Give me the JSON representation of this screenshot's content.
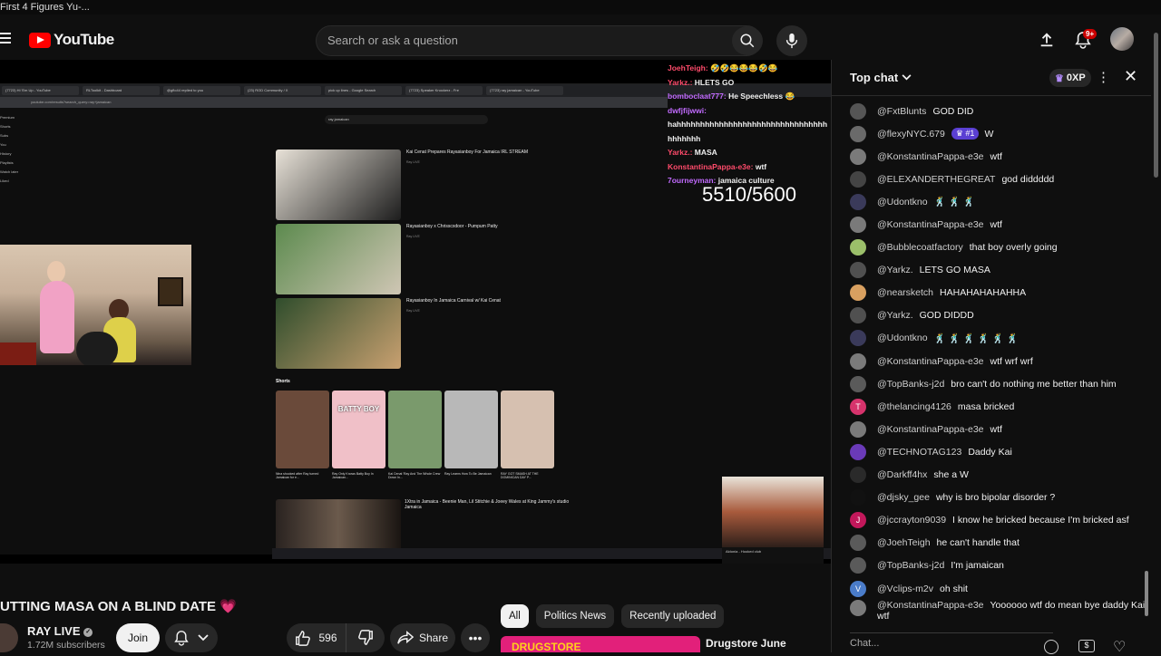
{
  "window": {
    "title": "First 4 Figures Yu-..."
  },
  "header": {
    "logo_text": "YouTube",
    "search_placeholder": "Search or ask a question",
    "notifications_badge": "9+"
  },
  "player": {
    "browser_tabs": [
      "(7723) Hi 'Em Up - YouTube",
      "RLToolkit - Dashboard",
      "@gflo44 replied to you",
      "(23) ROD Community / X",
      "pick up lines - Google Search",
      "(7723) Speaker Knockerz - Fre",
      "(7723) ray jamaican - YouTube"
    ],
    "url": "youtube.com/results?search_query=ray+jamaican",
    "mini_search": "ray jamaican",
    "results": [
      {
        "title": "Kai Cenat Prepares Rayasianboy For Jamaica IRL STREAM",
        "channel": "Ray LIVE",
        "thumb_colors": [
          "#e8e2d8",
          "#1d1d1d"
        ]
      },
      {
        "title": "Rayasianboy x Chrisscxdoor - Pumpum Patty",
        "channel": "Ray LIVE",
        "thumb_colors": [
          "#5c8a4e",
          "#cfc6b4"
        ]
      },
      {
        "title": "Rayasianboy In Jamaica Carnival w/ Kai Cenat",
        "channel": "Ray LIVE",
        "thumb_colors": [
          "#2f4d2c",
          "#c8a070"
        ]
      }
    ],
    "shorts_label": "Shorts",
    "shorts": [
      {
        "caption": "Nina shocked after Ray turned Jamaican for e...",
        "color": "#6a4a3a"
      },
      {
        "caption": "Ray Only Knows Batty Boy In Jamaican...",
        "color": "#f0c0c8",
        "text": "BATTY BOY"
      },
      {
        "caption": "Kai Cenat 'Ray And The Whole Crew Down In...",
        "color": "#7a9a6c"
      },
      {
        "caption": "Ray Learns How To Be Jamaican",
        "color": "#b8b8b8"
      },
      {
        "caption": "RAY GOT SMASH AT THE DOMINICAN DAY P...",
        "color": "#d6c0b0"
      }
    ],
    "bottom_result": "1Xtra in Jamaica - Beenie Man, Lil Stitchie & Joeey Wales at King Jammy's studio Jamaica",
    "overlay_chat": [
      {
        "name": "JoehTeigh:",
        "text": "🤣🤣😂😂😂🤣😂",
        "color": "r"
      },
      {
        "name": "Yarkz.:",
        "text": "HLETS GO",
        "color": "r"
      },
      {
        "name": "bomboclaat777:",
        "text": "He Speechless 😂",
        "color": "n"
      },
      {
        "name": "dwfjfijwwi:",
        "text": "hahhhhhhhhhhhhhhhhhhhhhhhhhhhhhhhh hhhhhhh",
        "color": "n"
      },
      {
        "name": "Yarkz.:",
        "text": "MASA",
        "color": "r"
      },
      {
        "name": "KonstantinaPappa-e3e:",
        "text": "wtf",
        "color": "r"
      },
      {
        "name": "7ourneyman:",
        "text": "jamaica culture",
        "color": "n"
      }
    ],
    "counter": "5510/5600",
    "mini_caption": "Aldonia - Hooked club"
  },
  "video": {
    "title": "UTTING MASA ON A BLIND DATE",
    "title_emoji": "💗",
    "channel": "RAY LIVE",
    "subscribers": "1.72M subscribers",
    "join_label": "Join",
    "likes": "596",
    "share_label": "Share"
  },
  "chips": [
    "All",
    "Politics News",
    "Recently uploaded"
  ],
  "ad": {
    "banner_text": "DRUGSTORE",
    "title": "Drugstore June"
  },
  "chat": {
    "title": "Top chat",
    "xp": "0XP",
    "input_placeholder": "Chat...",
    "messages": [
      {
        "author": "@FxtBlunts",
        "text": "GOD DID",
        "avatar_color": "#555555",
        "initial": ""
      },
      {
        "author": "@flexyNYC.679",
        "text": "W",
        "avatar_color": "#6a6a6a",
        "initial": "",
        "badge": "#1"
      },
      {
        "author": "@KonstantinaPappa-e3e",
        "text": "wtf",
        "avatar_color": "#7a7a7a",
        "initial": ""
      },
      {
        "author": "@ELEXANDERTHEGREAT",
        "text": "god diddddd",
        "avatar_color": "#444444",
        "initial": ""
      },
      {
        "author": "@Udontkno",
        "text": "🕺 🕺 🕺",
        "avatar_color": "#3a3a5a",
        "initial": ""
      },
      {
        "author": "@KonstantinaPappa-e3e",
        "text": "wtf",
        "avatar_color": "#7a7a7a",
        "initial": ""
      },
      {
        "author": "@Bubblecoatfactory",
        "text": "that boy overly going",
        "avatar_color": "#9bbf6a",
        "initial": ""
      },
      {
        "author": "@Yarkz.",
        "text": "LETS GO MASA",
        "avatar_color": "#505050",
        "initial": ""
      },
      {
        "author": "@nearsketch",
        "text": "HAHAHAHAHAHHA",
        "avatar_color": "#d8a060",
        "initial": ""
      },
      {
        "author": "@Yarkz.",
        "text": "GOD DIDDD",
        "avatar_color": "#505050",
        "initial": ""
      },
      {
        "author": "@Udontkno",
        "text": "🕺 🕺 🕺 🕺 🕺 🕺",
        "avatar_color": "#3a3a5a",
        "initial": ""
      },
      {
        "author": "@KonstantinaPappa-e3e",
        "text": "wtf wrf wrf",
        "avatar_color": "#7a7a7a",
        "initial": ""
      },
      {
        "author": "@TopBanks-j2d",
        "text": "bro can't do nothing me better than him",
        "avatar_color": "#5a5a5a",
        "initial": ""
      },
      {
        "author": "@thelancing4126",
        "text": "masa bricked",
        "avatar_color": "#d6336c",
        "initial": "T"
      },
      {
        "author": "@KonstantinaPappa-e3e",
        "text": "wtf",
        "avatar_color": "#7a7a7a",
        "initial": ""
      },
      {
        "author": "@TECHNOTAG123",
        "text": "Daddy Kai",
        "avatar_color": "#6a3ab8",
        "initial": ""
      },
      {
        "author": "@Darkff4hx",
        "text": "she a W",
        "avatar_color": "#2a2a2a",
        "initial": ""
      },
      {
        "author": "@djsky_gee",
        "text": "why is bro bipolar disorder ?",
        "avatar_color": "#111111",
        "initial": ""
      },
      {
        "author": "@jccrayton9039",
        "text": "I know he bricked because I'm bricked asf",
        "avatar_color": "#c2185b",
        "initial": "J"
      },
      {
        "author": "@JoehTeigh",
        "text": "he can't handle that",
        "avatar_color": "#5a5a5a",
        "initial": ""
      },
      {
        "author": "@TopBanks-j2d",
        "text": "I'm jamaican",
        "avatar_color": "#5a5a5a",
        "initial": ""
      },
      {
        "author": "@Vclips-m2v",
        "text": "oh shit",
        "avatar_color": "#4a7cc9",
        "initial": "V"
      },
      {
        "author": "@KonstantinaPappa-e3e",
        "text": "Yoooooo wtf do mean bye daddy Kai wtf",
        "avatar_color": "#7a7a7a",
        "initial": "",
        "tall": true
      }
    ]
  }
}
